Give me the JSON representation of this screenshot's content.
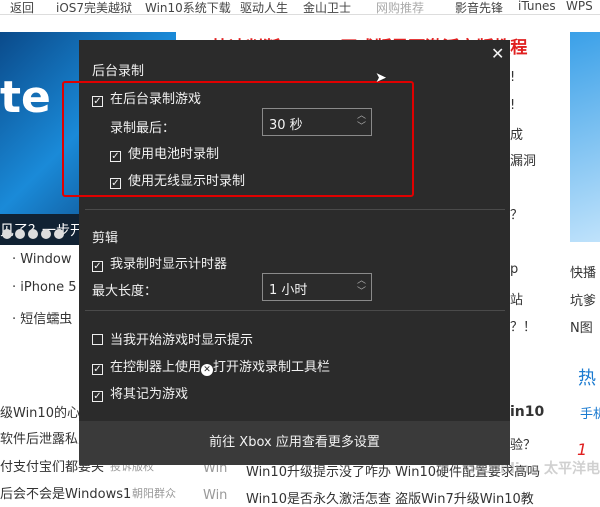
{
  "background": {
    "nav": [
      "返回",
      "iOS7完美越狱",
      "Win10系统下载",
      "驱动人生",
      "金山卫士",
      "网购推荐",
      "影音先锋",
      "iTunes",
      "WPS"
    ],
    "hero_text": "te",
    "hero_caption": "见了？一步开",
    "headline": "快速判断Win10正式版是否激活完版教程",
    "right_fragments": [
      "!",
      "!",
      "成",
      "漏洞",
      "？",
      "p",
      "站",
      "？！",
      "in10",
      "验？"
    ],
    "left_list": [
      "Window",
      "iPhone 5",
      "短信蠕虫"
    ],
    "left_news": [
      "级Win10的心",
      "软件后泄露私人",
      "付支付宝们都要关",
      "后会不会是Windows1"
    ],
    "left_news_src": [
      "",
      "",
      "投诉版权",
      "朝阳群众"
    ],
    "bottom_tag": [
      "Win",
      "Win"
    ],
    "bottom_news": [
      "Win10升级提示没了咋办 Win10硬件配置要求高吗",
      "Win10是否永久激活怎查 盗版Win7升级Win10教"
    ],
    "right_col": [
      "快播",
      "坑爹",
      "N图"
    ],
    "right_hot": "热",
    "right_link": "手机",
    "right_num": "1",
    "watermark": "PConline 太平洋电脑网"
  },
  "dialog": {
    "close_icon": "close-icon",
    "section1_title": "后台录制",
    "record_background": {
      "label": "在后台录制游戏",
      "checked": true
    },
    "record_last_label": "录制最后：",
    "record_last_value": "30 秒",
    "battery": {
      "label": "使用电池时录制",
      "checked": true
    },
    "wireless": {
      "label": "使用无线显示时录制",
      "checked": true
    },
    "section2_title": "剪辑",
    "show_timer": {
      "label": "我录制时显示计时器",
      "checked": true
    },
    "max_length_label": "最大长度：",
    "max_length_value": "1 小时",
    "show_tips": {
      "label": "当我开始游戏时显示提示",
      "checked": false
    },
    "controller_pre": "在控制器上使用",
    "controller_post": "打开游戏录制工具栏",
    "controller_checked": true,
    "remember_game": {
      "label": "将其记为游戏",
      "checked": true
    },
    "footer_link": "前往 Xbox 应用查看更多设置",
    "highlight_color": "#e00000"
  }
}
